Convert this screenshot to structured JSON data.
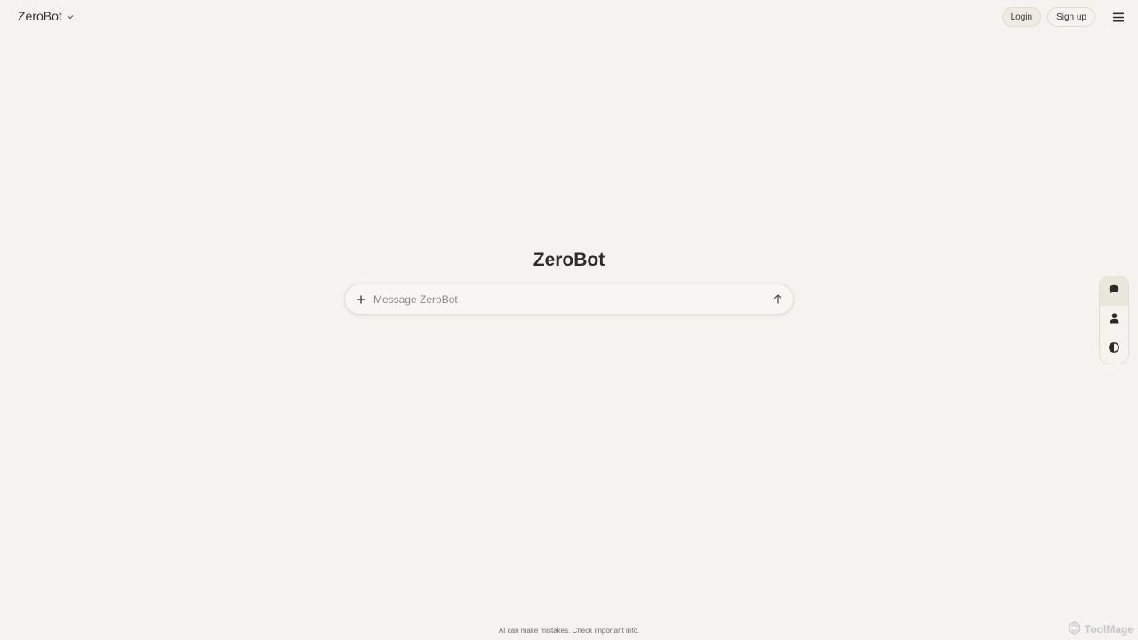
{
  "header": {
    "model_name": "ZeroBot",
    "login_label": "Login",
    "signup_label": "Sign up",
    "menu_icon": "hamburger-menu-icon"
  },
  "main": {
    "title": "ZeroBot",
    "composer": {
      "placeholder": "Message ZeroBot",
      "value": "",
      "attach_icon": "plus-icon",
      "send_icon": "arrow-up-icon"
    }
  },
  "rail": {
    "items": [
      {
        "icon": "chat-bubble-icon",
        "active": true
      },
      {
        "icon": "person-icon",
        "active": false
      },
      {
        "icon": "contrast-icon",
        "active": false
      }
    ]
  },
  "footer": {
    "disclaimer": "AI can make mistakes. Check important info.",
    "watermark": "ToolMage"
  },
  "colors": {
    "background": "#f4f3ef",
    "text": "#2b2b2b",
    "border": "#e1ded5",
    "active_rail": "#e9e6dc"
  }
}
